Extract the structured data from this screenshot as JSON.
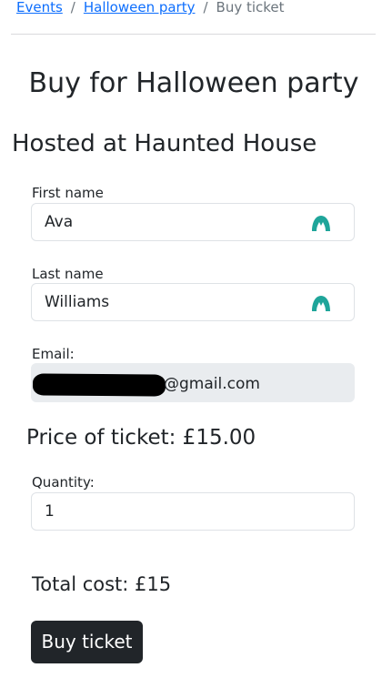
{
  "breadcrumb": {
    "items": [
      "Events",
      "Halloween party"
    ],
    "separator": "/",
    "current": "Buy ticket"
  },
  "page": {
    "title": "Buy for Halloween party",
    "subtitle": "Hosted at Haunted House"
  },
  "form": {
    "first_name": {
      "label": "First name",
      "value": "Ava"
    },
    "last_name": {
      "label": "Last name",
      "value": "Williams"
    },
    "email": {
      "label": "Email:",
      "value_visible": "@gmail.com",
      "redacted": true
    },
    "price_text": "Price of ticket: £15.00",
    "quantity": {
      "label": "Quantity:",
      "value": "1"
    },
    "total_text": "Total cost: £15",
    "submit_label": "Buy ticket"
  },
  "icons": {
    "autofill": "password-manager-autofill-icon"
  },
  "colors": {
    "link": "#0d6efd",
    "button_bg": "#212529",
    "autofill_icon": "#1fa59a",
    "readonly_bg": "#e9ecef"
  }
}
